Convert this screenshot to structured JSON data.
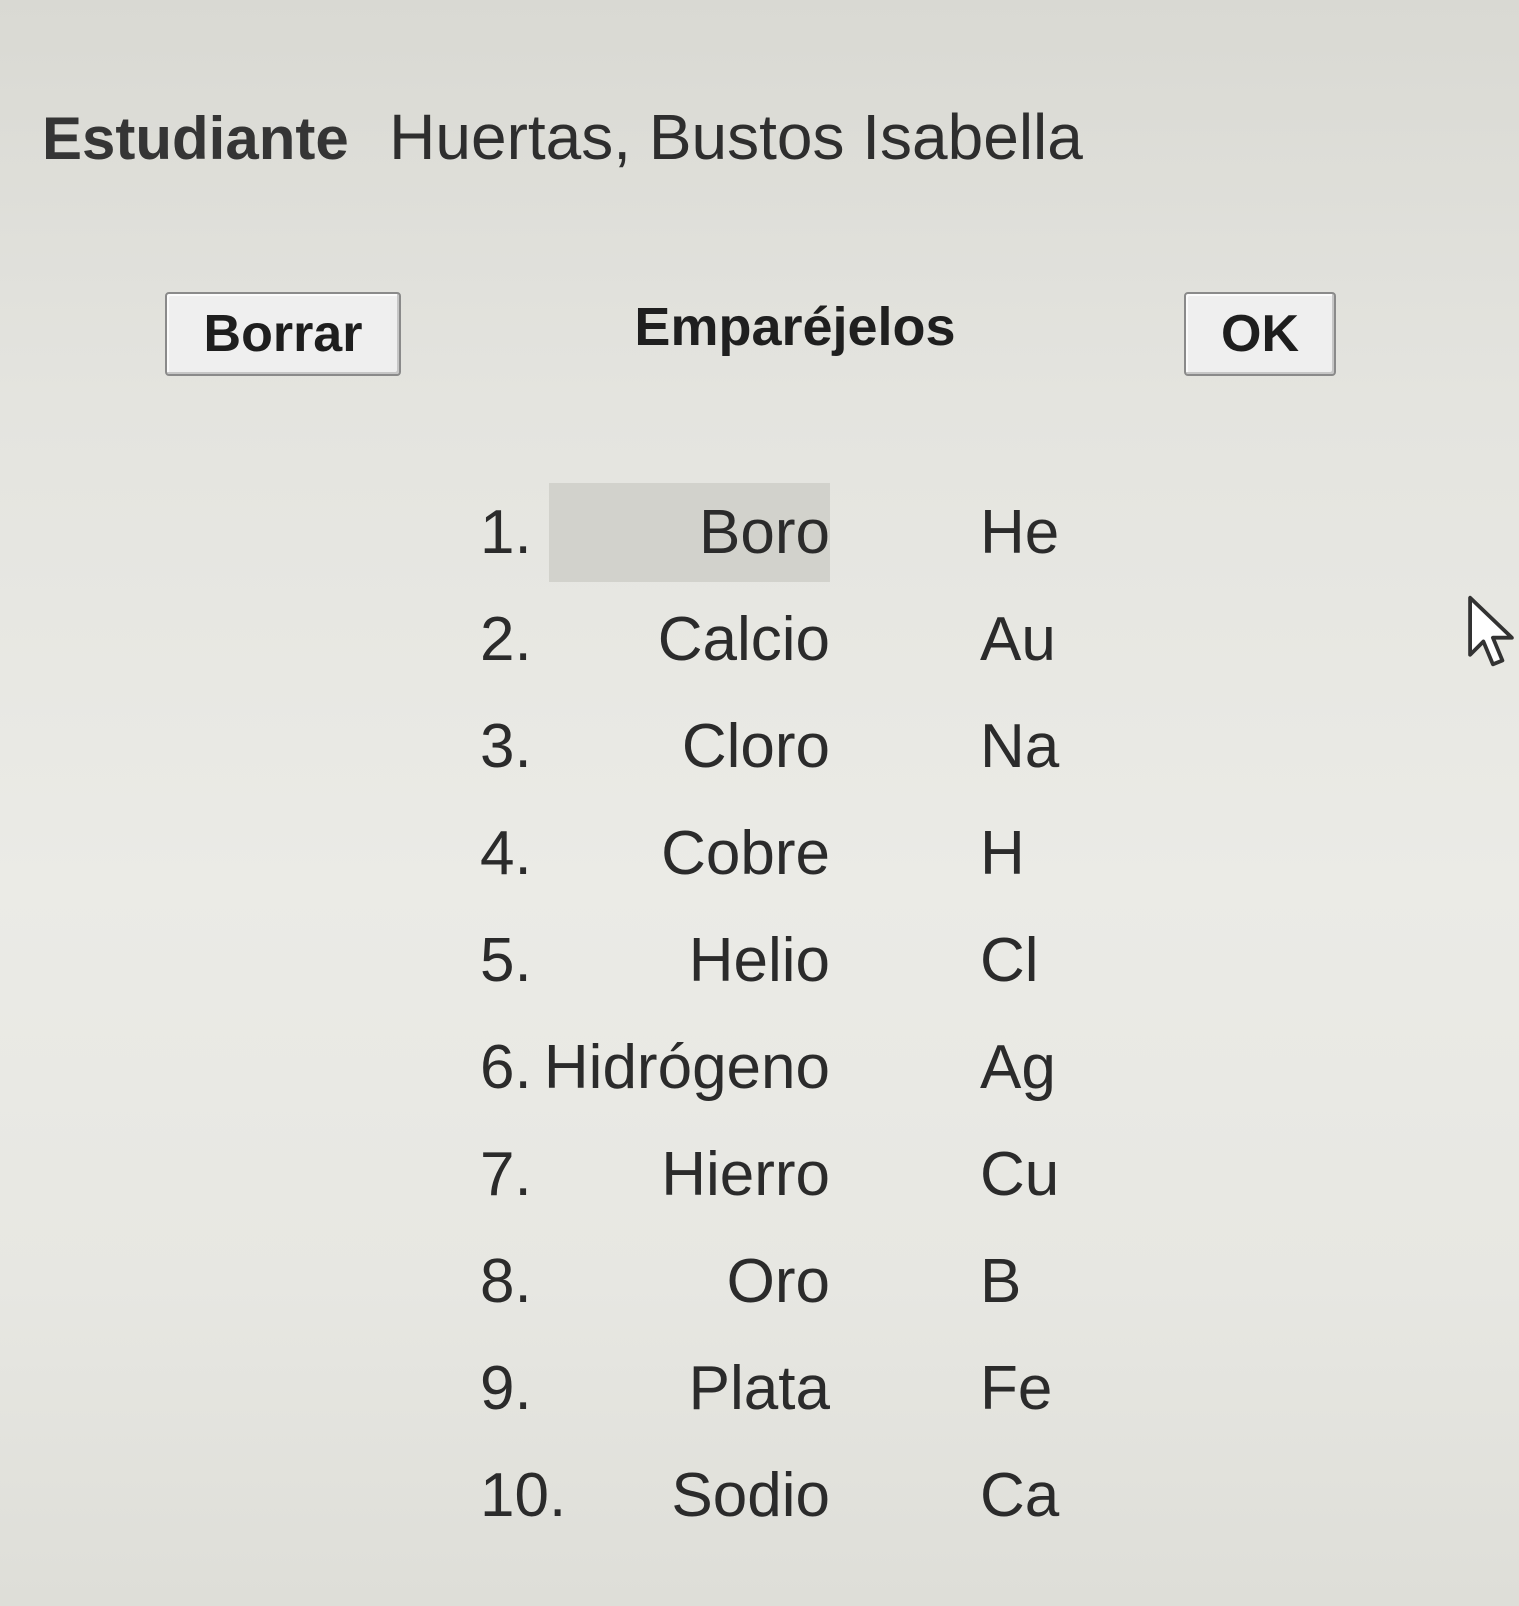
{
  "student": {
    "label": "Estudiante",
    "name": "Huertas, Bustos Isabella"
  },
  "toolbar": {
    "clear_label": "Borrar",
    "title": "Emparéjelos",
    "ok_label": "OK"
  },
  "items": [
    {
      "num": "1.",
      "name": "Boro",
      "symbol": "He"
    },
    {
      "num": "2.",
      "name": "Calcio",
      "symbol": "Au"
    },
    {
      "num": "3.",
      "name": "Cloro",
      "symbol": "Na"
    },
    {
      "num": "4.",
      "name": "Cobre",
      "symbol": "H"
    },
    {
      "num": "5.",
      "name": "Helio",
      "symbol": "Cl"
    },
    {
      "num": "6.",
      "name": "Hidrógeno",
      "symbol": "Ag"
    },
    {
      "num": "7.",
      "name": "Hierro",
      "symbol": "Cu"
    },
    {
      "num": "8.",
      "name": "Oro",
      "symbol": "B"
    },
    {
      "num": "9.",
      "name": "Plata",
      "symbol": "Fe"
    },
    {
      "num": "10.",
      "name": "Sodio",
      "symbol": "Ca"
    }
  ]
}
